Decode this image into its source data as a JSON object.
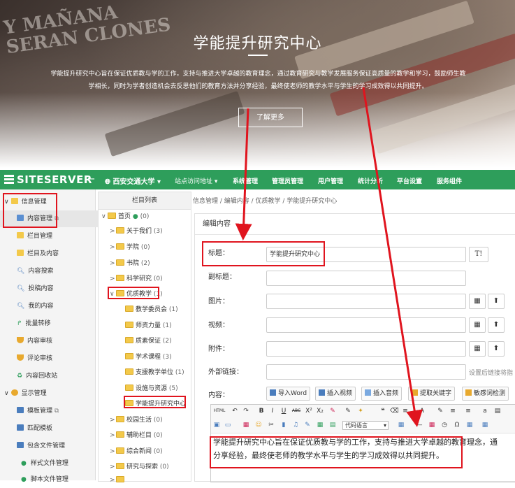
{
  "hero": {
    "bg_text": "Y MAÑANA\nSERAN CLONES",
    "title": "学能提升研究中心",
    "description_line1": "学能提升研究中心旨在保证优质教与学的工作，支持与推进大学卓越的教育理念，通过教育研究与教学发展服务保证高质量的教学和学习，鼓励师生教",
    "description_line2": "学相长，同时为学者创造机会去反思他们的教育方法并分享经验，最终使老师的教学水平与学生的学习成效得以共同提升。",
    "button": "了解更多"
  },
  "topbar": {
    "logo": "SITESERVER",
    "collapse_icon": "←",
    "site": "西安交通大学",
    "site_caret": "▾",
    "nav": [
      "站点访问地址 ▾",
      "系统管理",
      "管理员管理",
      "用户管理",
      "统计分析",
      "平台设置",
      "服务组件"
    ],
    "colors": {
      "bar": "#2e9e5b"
    }
  },
  "leftmenu": {
    "items": [
      {
        "label": "信息管理",
        "icon": "folder-icon"
      },
      {
        "label": "内容管理",
        "icon": "content-icon"
      },
      {
        "label": "栏目管理",
        "icon": "folder-icon"
      },
      {
        "label": "栏目及内容",
        "icon": "folder-icon"
      },
      {
        "label": "内容搜索",
        "icon": "search-icon"
      },
      {
        "label": "投稿内容",
        "icon": "search-icon"
      },
      {
        "label": "我的内容",
        "icon": "search-icon"
      },
      {
        "label": "批量转移",
        "icon": "transfer-icon"
      },
      {
        "label": "内容审核",
        "icon": "shield-icon"
      },
      {
        "label": "评论审核",
        "icon": "shield-icon"
      },
      {
        "label": "内容回收站",
        "icon": "recycle-icon"
      },
      {
        "label": "显示管理",
        "icon": "palette-icon"
      },
      {
        "label": "模板管理",
        "icon": "template-icon"
      },
      {
        "label": "匹配模板",
        "icon": "template-icon"
      },
      {
        "label": "包含文件管理",
        "icon": "file-icon"
      },
      {
        "label": "样式文件管理",
        "icon": "bullet-icon"
      },
      {
        "label": "脚本文件管理",
        "icon": "bullet-icon"
      }
    ]
  },
  "tree": {
    "header": "栏目列表",
    "nodes": [
      {
        "toggle": "∨",
        "label": "首页",
        "count": "(0)"
      },
      {
        "toggle": ">",
        "label": "关于我们",
        "count": "(3)"
      },
      {
        "toggle": ">",
        "label": "学院",
        "count": "(0)"
      },
      {
        "toggle": ">",
        "label": "书院",
        "count": "(2)"
      },
      {
        "toggle": ">",
        "label": "科学研究",
        "count": "(0)"
      },
      {
        "toggle": "∨",
        "label": "优质教学",
        "count": "(1)"
      },
      {
        "toggle": "",
        "label": "教学委员会",
        "count": "(1)"
      },
      {
        "toggle": "",
        "label": "师资力量",
        "count": "(1)"
      },
      {
        "toggle": "",
        "label": "质素保证",
        "count": "(2)"
      },
      {
        "toggle": "",
        "label": "学术课程",
        "count": "(3)"
      },
      {
        "toggle": "",
        "label": "支援教学单位",
        "count": "(1)"
      },
      {
        "toggle": "",
        "label": "设施与资源",
        "count": "(5)"
      },
      {
        "toggle": "",
        "label": "学能提升研究中心",
        "count": ""
      },
      {
        "toggle": ">",
        "label": "校园生活",
        "count": "(0)"
      },
      {
        "toggle": ">",
        "label": "辅助栏目",
        "count": "(0)"
      },
      {
        "toggle": ">",
        "label": "综合新闻",
        "count": "(0)"
      },
      {
        "toggle": ">",
        "label": "研究与探索",
        "count": "(0)"
      },
      {
        "toggle": ">",
        "label": "",
        "count": ""
      }
    ]
  },
  "main": {
    "breadcrumb": "信息管理 / 编辑内容 / 优质教学 / 学能提升研究中心",
    "panel_title": "编辑内容",
    "fields": {
      "title_label": "标题：",
      "title_value": "学能提升研究中心",
      "title_btn": "T!",
      "subtitle_label": "副标题：",
      "image_label": "图片：",
      "video_label": "视频：",
      "attach_label": "附件：",
      "link_label": "外部链接：",
      "link_hint": "设置后链接将指",
      "content_label": "内容："
    },
    "side_buttons": {
      "grid": "▦",
      "upload": "⬆"
    },
    "tools": [
      "导入Word",
      "插入视频",
      "插入音频",
      "提取关键字",
      "敏感词检测"
    ],
    "editor": {
      "toolbar_row1": [
        "HTML",
        "↶",
        "↷",
        "B",
        "I",
        "U",
        "ABC",
        "X²",
        "X₂",
        "✎",
        "❝",
        "≡",
        "≡",
        "a",
        "▤"
      ],
      "toolbar_row2": [
        "▣",
        "▭",
        "▦",
        "☺",
        "✂",
        "▮",
        "♫",
        "✎",
        "▦",
        "▤",
        "代码语言",
        "▦",
        "—",
        "▦",
        "◷",
        "Ω",
        "▦"
      ],
      "code_lang": "代码语言",
      "content": "学能提升研究中心旨在保证优质教与学的工作，支持与推进大学卓越的教育理念，通过教育研究与教学发展服务保证高质量的教学和学习，鼓励师生教学相长，同时为学者创造机会去反思他们的教育方法并分享经验，最终使老师的教学水平与学生的学习成效得以共同提升。",
      "content_line1": "学能提升研究中心旨在保证优质教与学的工作，支持与推进大学卓越的教育理念，通",
      "content_line2": "分享经验，最终使老师的教学水平与学生的学习成效得以共同提升。"
    }
  },
  "annotation_color": "#e0141e"
}
